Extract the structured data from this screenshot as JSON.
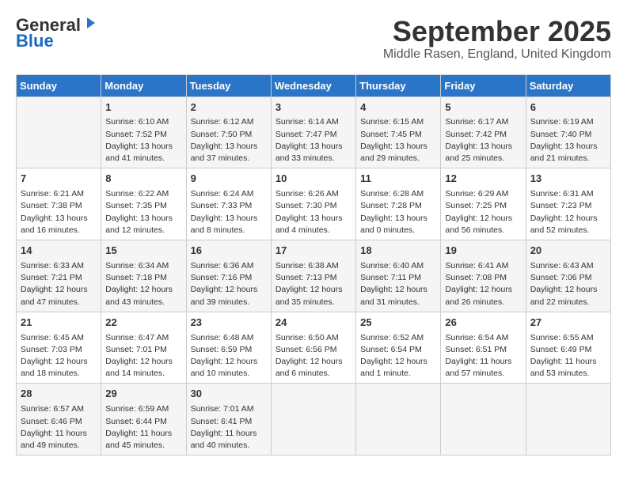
{
  "header": {
    "logo_general": "General",
    "logo_blue": "Blue",
    "month_title": "September 2025",
    "subtitle": "Middle Rasen, England, United Kingdom"
  },
  "days_of_week": [
    "Sunday",
    "Monday",
    "Tuesday",
    "Wednesday",
    "Thursday",
    "Friday",
    "Saturday"
  ],
  "weeks": [
    [
      {
        "num": "",
        "info": ""
      },
      {
        "num": "1",
        "info": "Sunrise: 6:10 AM\nSunset: 7:52 PM\nDaylight: 13 hours\nand 41 minutes."
      },
      {
        "num": "2",
        "info": "Sunrise: 6:12 AM\nSunset: 7:50 PM\nDaylight: 13 hours\nand 37 minutes."
      },
      {
        "num": "3",
        "info": "Sunrise: 6:14 AM\nSunset: 7:47 PM\nDaylight: 13 hours\nand 33 minutes."
      },
      {
        "num": "4",
        "info": "Sunrise: 6:15 AM\nSunset: 7:45 PM\nDaylight: 13 hours\nand 29 minutes."
      },
      {
        "num": "5",
        "info": "Sunrise: 6:17 AM\nSunset: 7:42 PM\nDaylight: 13 hours\nand 25 minutes."
      },
      {
        "num": "6",
        "info": "Sunrise: 6:19 AM\nSunset: 7:40 PM\nDaylight: 13 hours\nand 21 minutes."
      }
    ],
    [
      {
        "num": "7",
        "info": "Sunrise: 6:21 AM\nSunset: 7:38 PM\nDaylight: 13 hours\nand 16 minutes."
      },
      {
        "num": "8",
        "info": "Sunrise: 6:22 AM\nSunset: 7:35 PM\nDaylight: 13 hours\nand 12 minutes."
      },
      {
        "num": "9",
        "info": "Sunrise: 6:24 AM\nSunset: 7:33 PM\nDaylight: 13 hours\nand 8 minutes."
      },
      {
        "num": "10",
        "info": "Sunrise: 6:26 AM\nSunset: 7:30 PM\nDaylight: 13 hours\nand 4 minutes."
      },
      {
        "num": "11",
        "info": "Sunrise: 6:28 AM\nSunset: 7:28 PM\nDaylight: 13 hours\nand 0 minutes."
      },
      {
        "num": "12",
        "info": "Sunrise: 6:29 AM\nSunset: 7:25 PM\nDaylight: 12 hours\nand 56 minutes."
      },
      {
        "num": "13",
        "info": "Sunrise: 6:31 AM\nSunset: 7:23 PM\nDaylight: 12 hours\nand 52 minutes."
      }
    ],
    [
      {
        "num": "14",
        "info": "Sunrise: 6:33 AM\nSunset: 7:21 PM\nDaylight: 12 hours\nand 47 minutes."
      },
      {
        "num": "15",
        "info": "Sunrise: 6:34 AM\nSunset: 7:18 PM\nDaylight: 12 hours\nand 43 minutes."
      },
      {
        "num": "16",
        "info": "Sunrise: 6:36 AM\nSunset: 7:16 PM\nDaylight: 12 hours\nand 39 minutes."
      },
      {
        "num": "17",
        "info": "Sunrise: 6:38 AM\nSunset: 7:13 PM\nDaylight: 12 hours\nand 35 minutes."
      },
      {
        "num": "18",
        "info": "Sunrise: 6:40 AM\nSunset: 7:11 PM\nDaylight: 12 hours\nand 31 minutes."
      },
      {
        "num": "19",
        "info": "Sunrise: 6:41 AM\nSunset: 7:08 PM\nDaylight: 12 hours\nand 26 minutes."
      },
      {
        "num": "20",
        "info": "Sunrise: 6:43 AM\nSunset: 7:06 PM\nDaylight: 12 hours\nand 22 minutes."
      }
    ],
    [
      {
        "num": "21",
        "info": "Sunrise: 6:45 AM\nSunset: 7:03 PM\nDaylight: 12 hours\nand 18 minutes."
      },
      {
        "num": "22",
        "info": "Sunrise: 6:47 AM\nSunset: 7:01 PM\nDaylight: 12 hours\nand 14 minutes."
      },
      {
        "num": "23",
        "info": "Sunrise: 6:48 AM\nSunset: 6:59 PM\nDaylight: 12 hours\nand 10 minutes."
      },
      {
        "num": "24",
        "info": "Sunrise: 6:50 AM\nSunset: 6:56 PM\nDaylight: 12 hours\nand 6 minutes."
      },
      {
        "num": "25",
        "info": "Sunrise: 6:52 AM\nSunset: 6:54 PM\nDaylight: 12 hours\nand 1 minute."
      },
      {
        "num": "26",
        "info": "Sunrise: 6:54 AM\nSunset: 6:51 PM\nDaylight: 11 hours\nand 57 minutes."
      },
      {
        "num": "27",
        "info": "Sunrise: 6:55 AM\nSunset: 6:49 PM\nDaylight: 11 hours\nand 53 minutes."
      }
    ],
    [
      {
        "num": "28",
        "info": "Sunrise: 6:57 AM\nSunset: 6:46 PM\nDaylight: 11 hours\nand 49 minutes."
      },
      {
        "num": "29",
        "info": "Sunrise: 6:59 AM\nSunset: 6:44 PM\nDaylight: 11 hours\nand 45 minutes."
      },
      {
        "num": "30",
        "info": "Sunrise: 7:01 AM\nSunset: 6:41 PM\nDaylight: 11 hours\nand 40 minutes."
      },
      {
        "num": "",
        "info": ""
      },
      {
        "num": "",
        "info": ""
      },
      {
        "num": "",
        "info": ""
      },
      {
        "num": "",
        "info": ""
      }
    ]
  ]
}
